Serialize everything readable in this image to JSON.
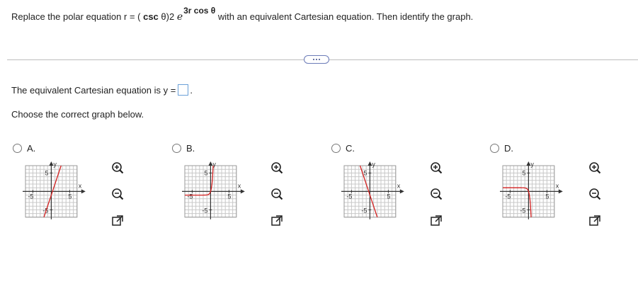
{
  "question": {
    "prefix": "Replace the polar equation r = ( ",
    "csc": "csc",
    "theta_mid": " θ)2 ",
    "e": "e",
    "exponent": "3r cos θ",
    "suffix": " with an equivalent Cartesian equation. Then identify the graph."
  },
  "more_button_label": "more",
  "answer": {
    "label": "The equivalent Cartesian equation is y =",
    "value": "",
    "trailing": "."
  },
  "choose_prompt": "Choose the correct graph below.",
  "colors": {
    "curve": "#d42020",
    "grid": "#c8c8c8",
    "axis": "#333333",
    "radio_border": "#777777",
    "answer_box": "#6aa0d8"
  },
  "options": [
    {
      "letter": "A.",
      "graph": {
        "xmin_label": "-5",
        "xmax_label": "5",
        "ytop_label": "5",
        "ybot_label": "-5",
        "xaxis": "x",
        "yaxis": "y",
        "curve": "line-up"
      }
    },
    {
      "letter": "B.",
      "graph": {
        "xmin_label": "-5",
        "xmax_label": "5",
        "ytop_label": "5",
        "ybot_label": "-5",
        "xaxis": "x",
        "yaxis": "y",
        "curve": "exp-up"
      }
    },
    {
      "letter": "C.",
      "graph": {
        "xmin_label": "-5",
        "xmax_label": "5",
        "ytop_label": "5",
        "ybot_label": "-5",
        "xaxis": "x",
        "yaxis": "y",
        "curve": "line-down"
      }
    },
    {
      "letter": "D.",
      "graph": {
        "xmin_label": "-5",
        "xmax_label": "5",
        "ytop_label": "5",
        "ybot_label": "-5",
        "xaxis": "x",
        "yaxis": "y",
        "curve": "exp-down"
      }
    }
  ],
  "tool_icons": [
    "zoom-in-icon",
    "zoom-out-icon",
    "open-new-window-icon"
  ]
}
